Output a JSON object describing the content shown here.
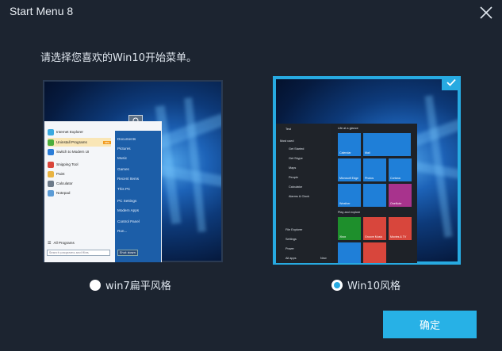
{
  "window": {
    "title": "Start Menu 8",
    "close_icon": "close-icon"
  },
  "prompt": "请选择您喜欢的Win10开始菜单。",
  "options": [
    {
      "id": "win7",
      "label": "win7扁平风格",
      "selected": false,
      "preview": {
        "left_items": [
          "Internet Explorer",
          "Uninstall Programs",
          "Switch to Modern UI",
          "Snipping Tool",
          "Paint",
          "Calculator",
          "Notepad"
        ],
        "badge": "new",
        "all_programs": "All Programs",
        "search_placeholder": "Search programs and files",
        "shutdown": "Shut down",
        "right_items": [
          "Documents",
          "Pictures",
          "Music",
          "Games",
          "Recent Items",
          "This PC",
          "PC Settings",
          "Modern Apps",
          "Control Panel",
          "Run..."
        ]
      }
    },
    {
      "id": "win10",
      "label": "Win10风格",
      "selected": true,
      "preview": {
        "user": "Test",
        "most_used": "Most used",
        "left_items": [
          "Get Started",
          "Get Skype",
          "Maps",
          "People",
          "Calculator",
          "Alarms & Clock"
        ],
        "bottom_items": [
          "File Explorer",
          "Settings",
          "Power",
          "All apps"
        ],
        "new_label": "New",
        "group1": "Life at a glance",
        "group2": "Play and explore",
        "tiles_row1": [
          "Calendar",
          "Mail"
        ],
        "tiles_row2": [
          "Microsoft Edge",
          "Photos",
          "Cortana"
        ],
        "tiles_row3": [
          "Weather",
          "",
          "OneNote"
        ],
        "tiles_row4": [
          "Xbox",
          "Groove Music",
          "Movies & TV"
        ]
      }
    }
  ],
  "confirm_label": "确定",
  "colors": {
    "background": "#1c2430",
    "accent": "#27aae1",
    "button": "#27b1e6"
  }
}
